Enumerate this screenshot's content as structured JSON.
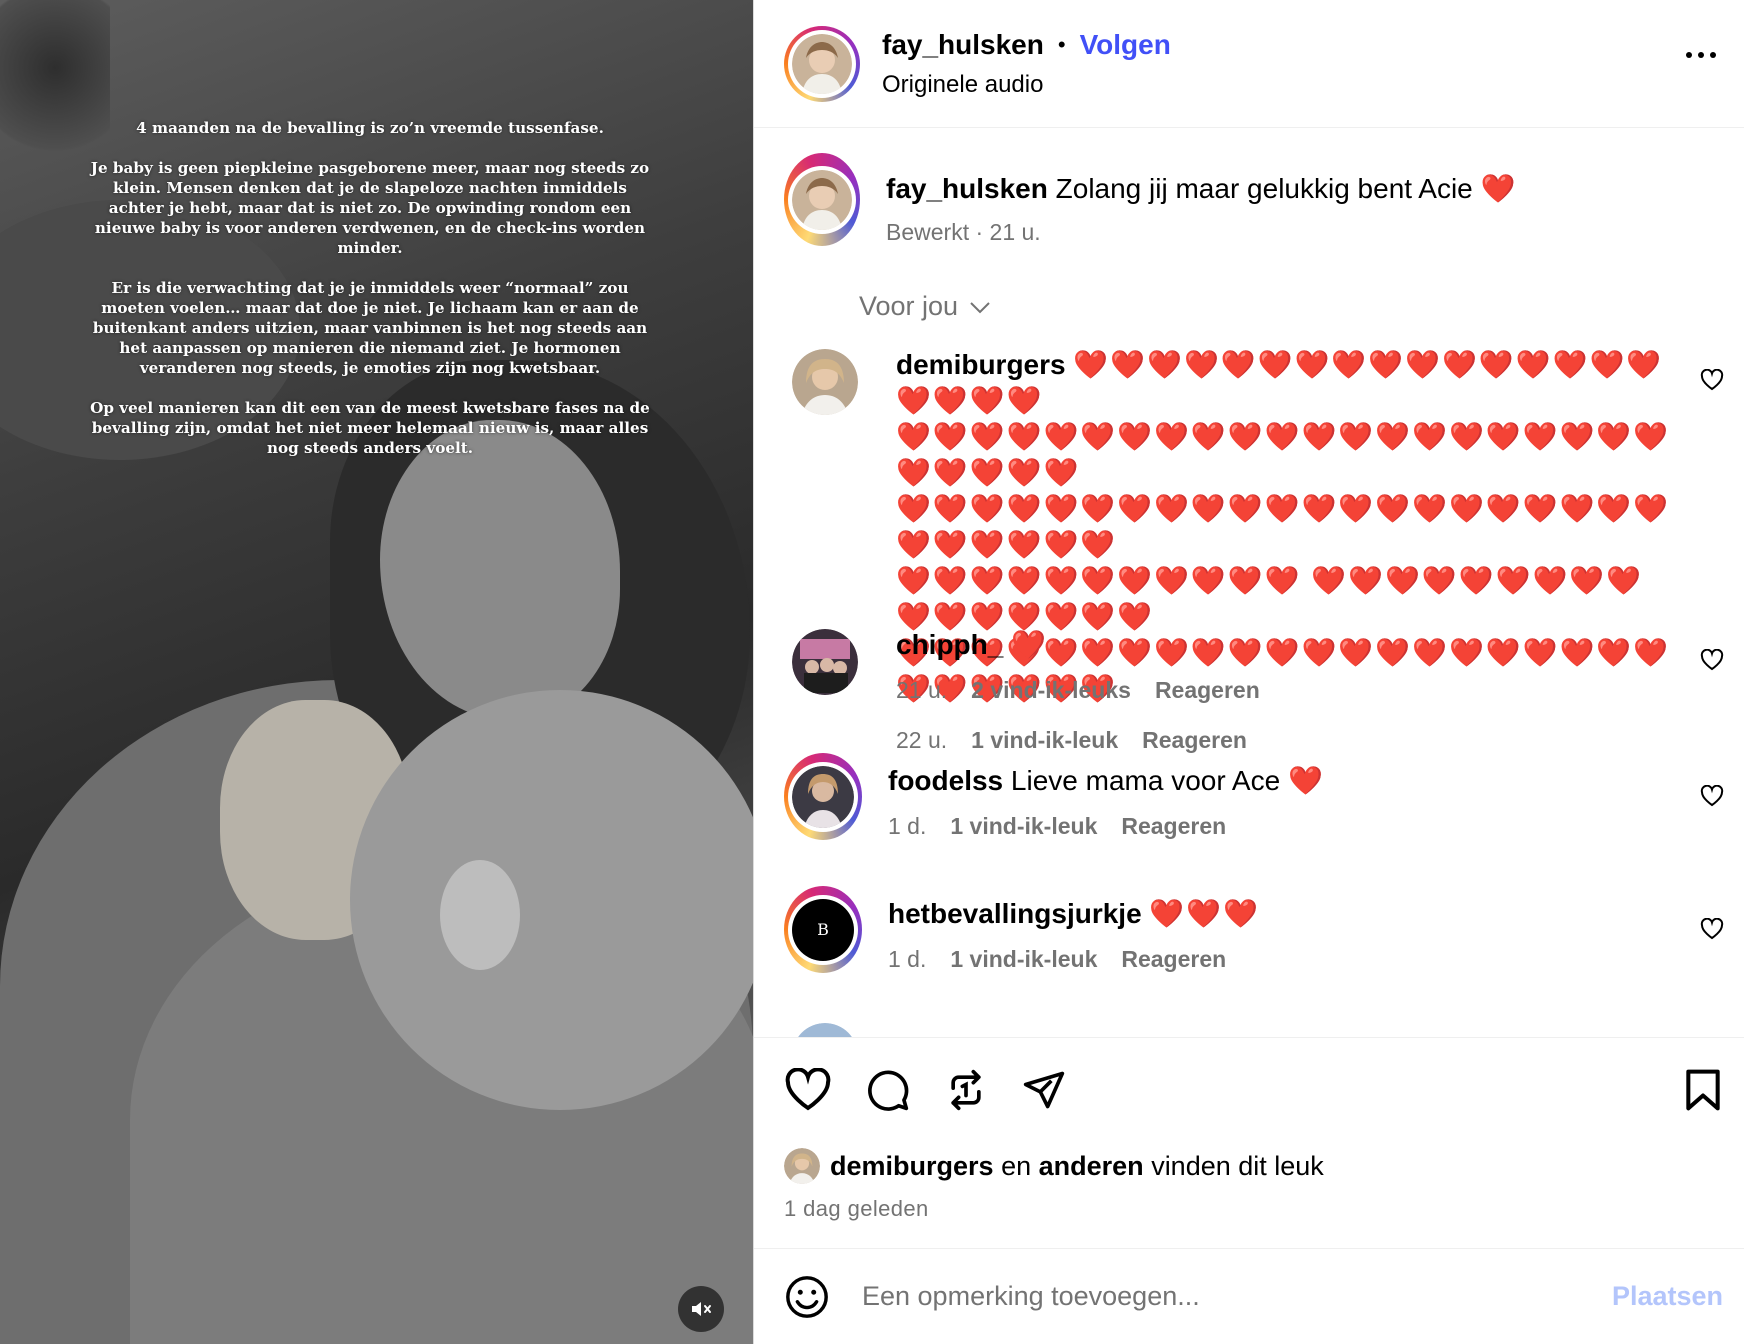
{
  "story": {
    "paragraphs": [
      "4 maanden na de bevalling is zo’n vreemde tussenfase.",
      "Je baby is geen piepkleine pasgeborene meer, maar nog steeds zo klein. Mensen denken dat je de slapeloze nachten inmiddels achter je hebt, maar dat is niet zo. De opwinding rondom een nieuwe baby is voor anderen verdwenen, en de check-ins worden minder.",
      "Er is die verwachting dat je je inmiddels weer “normaal” zou moeten voelen… maar dat doe je niet. Je lichaam kan er aan de buitenkant anders uitzien, maar vanbinnen is het nog steeds aan het aanpassen op manieren die niemand ziet. Je hormonen veranderen nog steeds, je emoties zijn nog kwetsbaar.",
      "Op veel manieren kan dit een van de meest kwetsbare fases na de bevalling zijn, omdat het niet meer helemaal nieuw is, maar alles nog steeds anders voelt."
    ],
    "mute_icon": "speaker-muted-icon"
  },
  "header": {
    "username": "fay_hulsken",
    "separator": "•",
    "follow_label": "Volgen",
    "audio": "Originele audio",
    "more_icon": "more-options-icon"
  },
  "caption": {
    "username": "fay_hulsken",
    "text": "Zolang jij maar gelukkig bent Acie ❤️",
    "edited": "Bewerkt",
    "time": "21 u."
  },
  "filter": {
    "label": "Voor jou",
    "icon": "chevron-down-icon"
  },
  "comments": [
    {
      "username": "demiburgers",
      "text_lines": [
        "❤️❤️❤️❤️❤️❤️❤️❤️❤️❤️❤️❤️❤️❤️❤️❤️❤️❤️❤️❤️",
        "❤️❤️❤️❤️❤️❤️❤️❤️❤️❤️❤️❤️❤️❤️❤️❤️❤️❤️❤️❤️❤️ ❤️❤️❤️❤️❤️",
        "❤️❤️❤️❤️❤️❤️❤️❤️❤️❤️❤️❤️❤️❤️❤️❤️❤️❤️❤️❤️❤️❤️❤️❤️❤️❤️❤️",
        "❤️❤️❤️❤️❤️❤️❤️❤️❤️❤️❤️ ❤️❤️❤️❤️❤️❤️❤️❤️❤️❤️❤️❤️❤️❤️❤️❤️",
        "❤️❤️❤️❤️❤️❤️❤️❤️❤️❤️❤️❤️❤️❤️❤️❤️❤️❤️❤️❤️❤️❤️❤️❤️❤️❤️❤️"
      ],
      "time": "22 u.",
      "likes": "1 vind-ik-leuk",
      "reply": "Reageren"
    },
    {
      "username": "chipph_",
      "text": "❤️",
      "time": "21 u.",
      "likes": "2 vind-ik-leuks",
      "reply": "Reageren"
    },
    {
      "username": "foodelss",
      "text": "Lieve mama voor Ace ❤️",
      "time": "1 d.",
      "likes": "1 vind-ik-leuk",
      "reply": "Reageren"
    },
    {
      "username": "hetbevallingsjurkje",
      "avatar_letter": "B",
      "text": "❤️❤️❤️",
      "time": "1 d.",
      "likes": "1 vind-ik-leuk",
      "reply": "Reageren"
    }
  ],
  "likes": {
    "user": "demiburgers",
    "connector": "en",
    "others": "anderen",
    "suffix": "vinden dit leuk",
    "timestamp": "1 dag geleden"
  },
  "add_comment": {
    "placeholder": "Een opmerking toevoegen...",
    "post_label": "Plaatsen",
    "emoji_icon": "emoji-smile-icon"
  },
  "colors": {
    "follow": "#4150f7",
    "post_disabled": "#b3c5fb",
    "secondary_text": "#737373",
    "heart": "#e8141c"
  }
}
